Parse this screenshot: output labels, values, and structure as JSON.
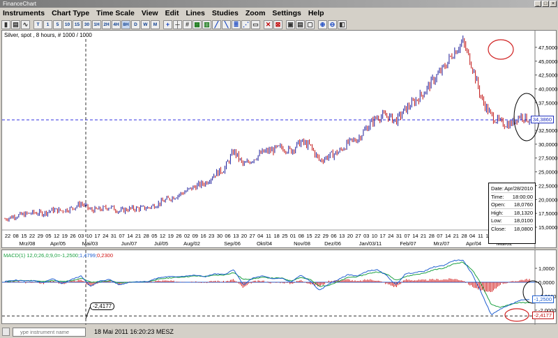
{
  "window": {
    "title": "FinanceChart",
    "buttons": [
      "_",
      "□",
      "×"
    ]
  },
  "menu": [
    "Instruments",
    "Chart Type",
    "Time Scale",
    "View",
    "Edit",
    "Lines",
    "Studies",
    "Zoom",
    "Settings",
    "Help"
  ],
  "toolbar": {
    "chart_type_buttons": [
      {
        "label": "▮",
        "name": "bar-chart-icon"
      },
      {
        "label": "▤",
        "name": "candle-chart-icon"
      },
      {
        "label": "∿",
        "name": "line-chart-icon"
      }
    ],
    "timescale_buttons": [
      {
        "label": "T",
        "active": false
      },
      {
        "label": "1",
        "active": false
      },
      {
        "label": "5",
        "active": false
      },
      {
        "label": "10",
        "active": false
      },
      {
        "label": "15",
        "active": false
      },
      {
        "label": "30",
        "active": false
      },
      {
        "label": "1H",
        "active": false
      },
      {
        "label": "2H",
        "active": false
      },
      {
        "label": "4H",
        "active": false
      },
      {
        "label": "8H",
        "active": true
      },
      {
        "label": "D",
        "active": false
      },
      {
        "label": "W",
        "active": false
      },
      {
        "label": "M",
        "active": false
      }
    ],
    "tool_buttons": [
      {
        "label": "+",
        "name": "crosshair-icon"
      },
      {
        "label": "┼",
        "name": "cursor-icon"
      },
      {
        "label": "#",
        "name": "grid-icon"
      },
      {
        "label": "▦",
        "name": "table-icon"
      },
      {
        "label": "▥",
        "name": "volume-icon"
      },
      {
        "label": "╱",
        "name": "trendline-icon"
      },
      {
        "label": "╲",
        "name": "parallel-line-icon"
      },
      {
        "label": "≣",
        "name": "fibonacci-icon"
      },
      {
        "label": "⋰",
        "name": "fan-icon"
      },
      {
        "label": "▭",
        "name": "rectangle-icon"
      },
      {
        "label": "✕",
        "name": "delete-icon"
      },
      {
        "label": "⊠",
        "name": "delete-all-icon"
      },
      {
        "label": "▣",
        "name": "chart-window-icon"
      },
      {
        "label": "▤",
        "name": "print-icon"
      },
      {
        "label": "▢",
        "name": "export-icon"
      },
      {
        "label": "⊕",
        "name": "zoom-in-icon"
      },
      {
        "label": "⊖",
        "name": "zoom-out-icon"
      },
      {
        "label": "◧",
        "name": "split-view-icon"
      }
    ]
  },
  "chart": {
    "instrument_label": "Silver, spot , 8 hours, # 1000 / 1000",
    "current_price_tag": "34,3860",
    "y_ticks": [
      "47,5000",
      "45,0000",
      "42,5000",
      "40,0000",
      "37,5000",
      "32,5000",
      "30,0000",
      "27,5000",
      "25,0000",
      "22,5000",
      "20,0000",
      "17,5000",
      "15,0000"
    ],
    "x_day_ticks": [
      "22",
      "08",
      "15",
      "22",
      "29",
      "05",
      "12",
      "19",
      "26",
      "03",
      "10",
      "17",
      "24",
      "31",
      "07",
      "14",
      "21",
      "28",
      "05",
      "12",
      "19",
      "26",
      "02",
      "09",
      "16",
      "23",
      "30",
      "06",
      "13",
      "20",
      "27",
      "04",
      "11",
      "18",
      "25",
      "01",
      "08",
      "15",
      "22",
      "29",
      "06",
      "13",
      "20",
      "27",
      "03",
      "10",
      "17",
      "24",
      "31",
      "07",
      "14",
      "21",
      "28",
      "07",
      "14",
      "21",
      "28",
      "04",
      "11",
      "18",
      "25",
      "02",
      "09",
      "16",
      "23"
    ],
    "x_month_ticks": [
      "Mrz/08",
      "Apr/05",
      "Mai/03",
      "Jun/07",
      "Jul/05",
      "Aug/02",
      "Sep/06",
      "Okt/04",
      "Nov/08",
      "Dez/06",
      "Jan/03/11",
      "Feb/07",
      "Mrz/07",
      "Apr/04",
      "Mai/02"
    ],
    "info": {
      "date_label": "Date:",
      "date": "Apr/28/2010",
      "time_label": "Time:",
      "time": "18:00:00",
      "open_label": "Open:",
      "open": "18,0760",
      "high_label": "High:",
      "high": "18,1320",
      "low_label": "Low:",
      "low": "18,0100",
      "close_label": "Close:",
      "close": "18,0800"
    }
  },
  "chart_data": {
    "type": "line",
    "series": [
      {
        "name": "Silver, spot",
        "values": [
          16.5,
          17.0,
          17.3,
          17.6,
          17.5,
          18.1,
          18.0,
          18.4,
          19.3,
          18.1,
          18.2,
          18.7,
          17.9,
          18.3,
          18.4,
          18.5,
          19.2,
          20.0,
          20.7,
          21.5,
          22.4,
          23.0,
          24.6,
          25.5,
          28.8,
          26.2,
          27.3,
          28.5,
          28.9,
          29.4,
          28.8,
          30.4,
          29.7,
          27.0,
          27.9,
          28.6,
          30.2,
          31.0,
          33.1,
          34.9,
          35.2,
          34.2,
          36.3,
          37.8,
          39.5,
          41.8,
          43.7,
          46.5,
          48.5,
          44.2,
          38.0,
          35.1,
          33.8,
          33.6,
          35.2,
          34.4
        ]
      }
    ],
    "ylim": [
      15.0,
      49.0
    ],
    "current_price": 34.386,
    "macd": {
      "label": "MACD(1) 12,0;26,0;9,0=-1,2500",
      "label2": ";1,4799;",
      "label3": "0,2300",
      "y_ticks": [
        "1,0000",
        "0,0000",
        "-1,0000",
        "-2,0000"
      ],
      "current_tag": "-1,2500",
      "min_tag": "-2,4177",
      "callout": "-2,4177",
      "ylim": [
        -2.7,
        1.9
      ],
      "macd_line": [
        0.05,
        0.15,
        0.1,
        0.12,
        -0.05,
        0.25,
        -0.1,
        0.2,
        0.45,
        -0.3,
        0.1,
        0.2,
        -0.2,
        0.0,
        0.05,
        0.05,
        0.3,
        0.4,
        0.4,
        0.45,
        0.5,
        0.4,
        0.6,
        0.55,
        0.9,
        -0.2,
        0.3,
        0.45,
        0.25,
        0.3,
        0.0,
        0.5,
        0.1,
        -0.6,
        -0.1,
        0.2,
        0.55,
        0.45,
        0.8,
        0.9,
        0.5,
        -0.2,
        0.6,
        0.7,
        0.8,
        1.1,
        1.2,
        1.55,
        1.6,
        0.6,
        -0.8,
        -2.35,
        -1.9,
        -1.6,
        -1.3,
        -1.25
      ],
      "signal_line": [
        0.05,
        0.1,
        0.12,
        0.12,
        0.05,
        0.12,
        0.05,
        0.1,
        0.3,
        0.0,
        0.05,
        0.12,
        -0.05,
        0.0,
        0.02,
        0.05,
        0.2,
        0.3,
        0.35,
        0.4,
        0.45,
        0.42,
        0.5,
        0.52,
        0.7,
        0.2,
        0.25,
        0.35,
        0.3,
        0.3,
        0.1,
        0.35,
        0.2,
        -0.3,
        -0.2,
        0.05,
        0.35,
        0.4,
        0.6,
        0.75,
        0.6,
        0.15,
        0.4,
        0.55,
        0.65,
        0.9,
        1.0,
        1.3,
        1.45,
        0.9,
        -0.2,
        -1.6,
        -1.8,
        -1.6,
        -1.45,
        -1.48
      ],
      "histogram": [
        0.0,
        0.05,
        -0.02,
        0.0,
        -0.1,
        0.13,
        -0.15,
        0.1,
        0.15,
        -0.3,
        0.05,
        0.08,
        -0.15,
        0.0,
        0.03,
        0.0,
        0.1,
        0.1,
        0.05,
        0.05,
        0.05,
        -0.02,
        0.1,
        0.03,
        0.2,
        -0.4,
        0.05,
        0.1,
        -0.05,
        0.0,
        -0.1,
        0.15,
        -0.1,
        -0.3,
        0.1,
        0.15,
        0.2,
        0.05,
        0.2,
        0.15,
        -0.1,
        -0.35,
        0.2,
        0.15,
        0.15,
        0.2,
        0.2,
        0.25,
        0.15,
        -0.3,
        -0.6,
        -0.75,
        -0.1,
        0.0,
        0.15,
        0.23
      ]
    }
  },
  "status": {
    "instrument_placeholder": "ype instrument name",
    "timestamp": "18 Mai 2011 16:20:23 MESZ"
  },
  "colors": {
    "up_candle": "#1a1a9a",
    "down_candle": "#c01010",
    "crosshair": "#3030e0",
    "macd": "#1f5fd0",
    "signal": "#1aa040",
    "hist_neg": "#d01010",
    "hist_pos": "#d01010"
  }
}
